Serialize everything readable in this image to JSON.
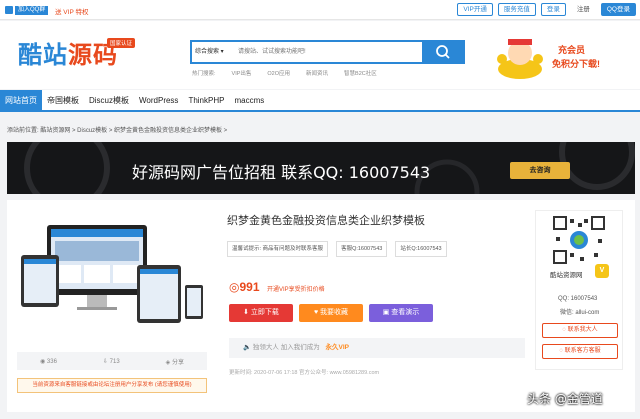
{
  "topbar": {
    "join_qq": "加入QQ群",
    "vip_promo": "送 VIP 特权",
    "buttons": [
      "VIP开通",
      "服务充值",
      "登录",
      "注册",
      "QQ登录"
    ]
  },
  "header": {
    "logo_part1": "酷站",
    "logo_part2": "源码",
    "logo_badge": "国家认证",
    "search_category": "综合搜索",
    "search_placeholder": "请搜站、试试搜索功能吧!",
    "hot_label": "热门搜索:",
    "hot_items": [
      "VIP出售",
      "O2O应用",
      "新闻资讯",
      "智慧B2C社区"
    ],
    "promo_line1": "充会员",
    "promo_line2": "免积分下载!"
  },
  "nav": [
    "网站首页",
    "帝国模板",
    "Discuz模板",
    "WordPress",
    "ThinkPHP",
    "maccms"
  ],
  "breadcrumb": "添站前位置: 酷站资源网 > Discuz模板 > 织梦金黄色金融投资信息类企业织梦模板 >",
  "banner": {
    "text": "好源码网广告位招租   联系QQ: 16007543",
    "button": "去咨询"
  },
  "product": {
    "title": "织梦金黄色金融投资信息类企业织梦模板",
    "info": [
      "温馨试提示: 商品有问题及时联系客服",
      "客服Q:16007543",
      "站长Q:16007543"
    ],
    "price": "991",
    "price_note": "开通VIP享受折扣价格",
    "btn_download": "立即下载",
    "btn_favorite": "我要收藏",
    "btn_demo": "查看演示",
    "vip_text": "独领大人 加入我们成为",
    "vip_highlight": "永久VIP",
    "meta": "更新时间: 2020-07-06 17:18   官方公众号: www.05981289.com",
    "stats": [
      "336",
      "713",
      "分享"
    ],
    "notice": "当前资源来自客服链接或由论坛注册用户分享发布 (请您谨慎使用)"
  },
  "sidebar": {
    "name": "酷站资源网",
    "vip": "V",
    "qq": "QQ: 16007543",
    "site": "微信: allui-com",
    "btn_contact": "联系我大人",
    "btn_service": "联系客方客服"
  },
  "watermark": "头条 @金管道"
}
